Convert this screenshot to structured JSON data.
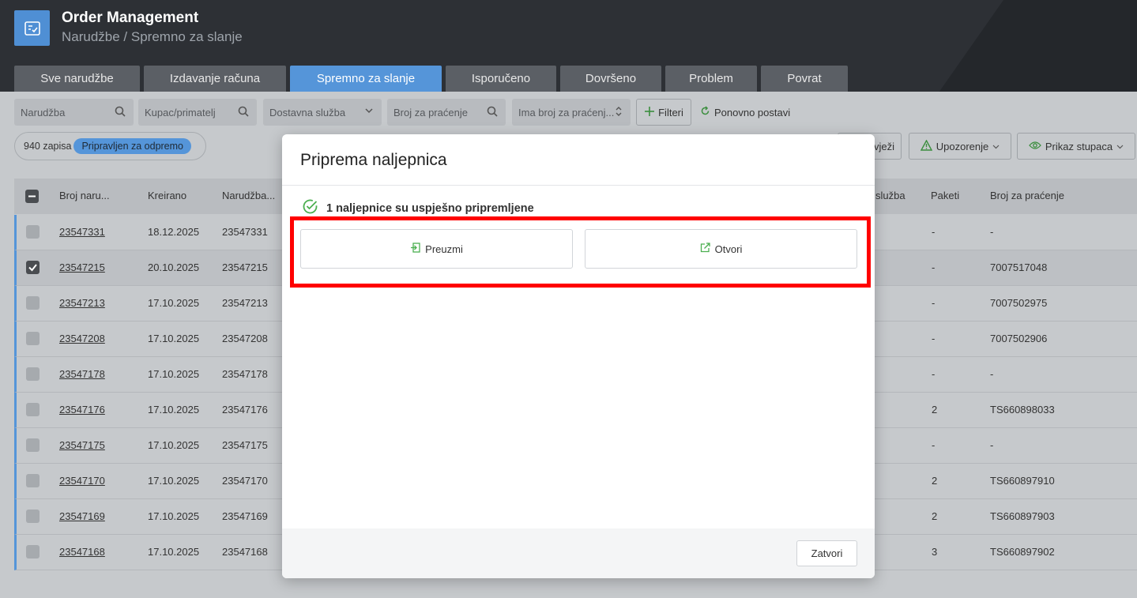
{
  "app": {
    "title": "Order Management",
    "subtitle": "Narudžbe / Spremno za slanje"
  },
  "tabs": [
    {
      "label": "Sve narudžbe",
      "active": false
    },
    {
      "label": "Izdavanje računa",
      "active": false
    },
    {
      "label": "Spremno za slanje",
      "active": true
    },
    {
      "label": "Isporučeno",
      "active": false
    },
    {
      "label": "Dovršeno",
      "active": false
    },
    {
      "label": "Problem",
      "active": false
    },
    {
      "label": "Povrat",
      "active": false
    }
  ],
  "filters": {
    "order": "Narudžba",
    "customer": "Kupac/primatelj",
    "delivery_service": "Dostavna služba",
    "tracking_number": "Broj za praćenje",
    "has_tracking": "Ima broj za praćenj...",
    "filters_button": "Filteri",
    "reset_button": "Ponovno postavi"
  },
  "summary": {
    "count": "940 zapisa",
    "status": "Pripravljen za odpremo"
  },
  "toolbar": {
    "refresh": "vježi",
    "warning": "Upozorenje",
    "columns": "Prikaz stupaca"
  },
  "table": {
    "headers": {
      "order_no": "Broj naru...",
      "created": "Kreirano",
      "order": "Narudžba...",
      "service": "služba",
      "packages": "Paketi",
      "tracking": "Broj za praćenje"
    },
    "rows": [
      {
        "order_no": "23547331",
        "created": "18.12.2025",
        "order": "23547331",
        "packages": "-",
        "tracking": "-",
        "selected": false
      },
      {
        "order_no": "23547215",
        "created": "20.10.2025",
        "order": "23547215",
        "packages": "-",
        "tracking": "7007517048",
        "selected": true
      },
      {
        "order_no": "23547213",
        "created": "17.10.2025",
        "order": "23547213",
        "packages": "-",
        "tracking": "7007502975",
        "selected": false
      },
      {
        "order_no": "23547208",
        "created": "17.10.2025",
        "order": "23547208",
        "packages": "-",
        "tracking": "7007502906",
        "selected": false
      },
      {
        "order_no": "23547178",
        "created": "17.10.2025",
        "order": "23547178",
        "packages": "-",
        "tracking": "-",
        "selected": false
      },
      {
        "order_no": "23547176",
        "created": "17.10.2025",
        "order": "23547176",
        "packages": "2",
        "tracking": "TS660898033",
        "selected": false
      },
      {
        "order_no": "23547175",
        "created": "17.10.2025",
        "order": "23547175",
        "packages": "-",
        "tracking": "-",
        "selected": false
      },
      {
        "order_no": "23547170",
        "created": "17.10.2025",
        "order": "23547170",
        "packages": "2",
        "tracking": "TS660897910",
        "selected": false
      },
      {
        "order_no": "23547169",
        "created": "17.10.2025",
        "order": "23547169",
        "packages": "2",
        "tracking": "TS660897903",
        "selected": false
      },
      {
        "order_no": "23547168",
        "created": "17.10.2025",
        "order": "23547168",
        "packages": "3",
        "tracking": "TS660897902",
        "selected": false
      }
    ]
  },
  "modal": {
    "title": "Priprema naljepnica",
    "success_message": "1 naljepnice su uspješno pripremljene",
    "download_button": "Preuzmi",
    "open_button": "Otvori",
    "close_button": "Zatvori"
  },
  "colors": {
    "accent": "#5595d9",
    "success": "#4caf50",
    "highlight": "#ff0000",
    "header_bg": "#2d3035"
  }
}
